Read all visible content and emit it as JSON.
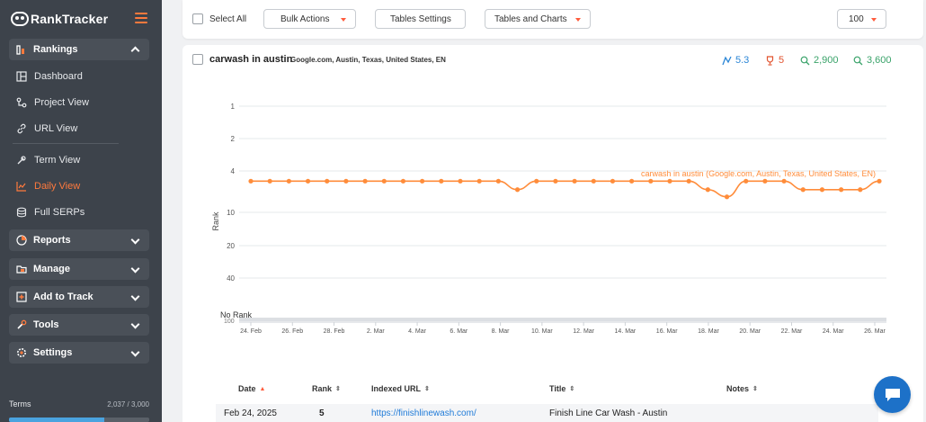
{
  "app": {
    "logo_text": "RankTracker"
  },
  "sidebar": {
    "rankings_label": "Rankings",
    "items_a": [
      {
        "label": "Dashboard",
        "icon": "dashboard-icon"
      },
      {
        "label": "Project View",
        "icon": "project-icon"
      },
      {
        "label": "URL View",
        "icon": "link-icon"
      }
    ],
    "items_b": [
      {
        "label": "Term View",
        "icon": "term-icon"
      },
      {
        "label": "Daily View",
        "icon": "chart-line-icon",
        "active": true
      },
      {
        "label": "Full SERPs",
        "icon": "serp-icon"
      }
    ],
    "sections": [
      {
        "label": "Reports",
        "icon": "reports-icon"
      },
      {
        "label": "Manage",
        "icon": "manage-icon"
      },
      {
        "label": "Add to Track",
        "icon": "add-icon"
      },
      {
        "label": "Tools",
        "icon": "tools-icon"
      },
      {
        "label": "Settings",
        "icon": "settings-icon"
      }
    ],
    "terms_label": "Terms",
    "terms_count": "2,037 / 3,000",
    "terms_fraction": 0.679
  },
  "toolbar": {
    "select_all": "Select All",
    "bulk_actions": "Bulk Actions",
    "tables_settings": "Tables Settings",
    "tables_and_charts": "Tables and Charts",
    "per_page": "100"
  },
  "keyword": {
    "title": "carwash in austin",
    "location": "Google.com, Austin, Texas, United States, EN",
    "stats": {
      "avg_rank": "5.3",
      "best_rank": "5",
      "search_volume": "2,900",
      "other_volume": "3,600"
    }
  },
  "colors": {
    "accent": "#ff7a3d",
    "line": "#ff8c3a",
    "blue": "#2b86d6",
    "green": "#3aa36a",
    "sidebar_bg": "#3d434b"
  },
  "chart_data": {
    "type": "line",
    "xlabel": "",
    "ylabel": "Rank",
    "y_scale": "log",
    "y_inverted": true,
    "y_ticks": [
      "1",
      "2",
      "4",
      "10",
      "20",
      "40",
      "No Rank"
    ],
    "y_bottom_label": "100",
    "x_ticks": [
      "24. Feb",
      "26. Feb",
      "28. Feb",
      "2. Mar",
      "4. Mar",
      "6. Mar",
      "8. Mar",
      "10. Mar",
      "12. Mar",
      "14. Mar",
      "16. Mar",
      "18. Mar",
      "20. Mar",
      "22. Mar",
      "24. Mar",
      "26. Mar"
    ],
    "grid": true,
    "series": [
      {
        "name": "carwash in austin (Google.com, Austin, Texas, United States, EN)",
        "values": [
          5,
          5,
          5,
          5,
          5,
          5,
          5,
          5,
          5,
          5,
          5,
          5,
          5,
          5,
          6,
          5,
          5,
          5,
          5,
          5,
          5,
          5,
          5,
          5,
          6,
          7,
          5,
          5,
          5,
          6,
          6,
          6,
          6,
          5
        ]
      }
    ]
  },
  "table": {
    "headers": {
      "date": "Date",
      "rank": "Rank",
      "url": "Indexed URL",
      "title": "Title",
      "notes": "Notes"
    },
    "rows": [
      {
        "date": "Feb 24, 2025",
        "rank": "5",
        "url": "https://finishlinewash.com/",
        "title": "Finish Line Car Wash - Austin",
        "notes": ""
      }
    ]
  }
}
